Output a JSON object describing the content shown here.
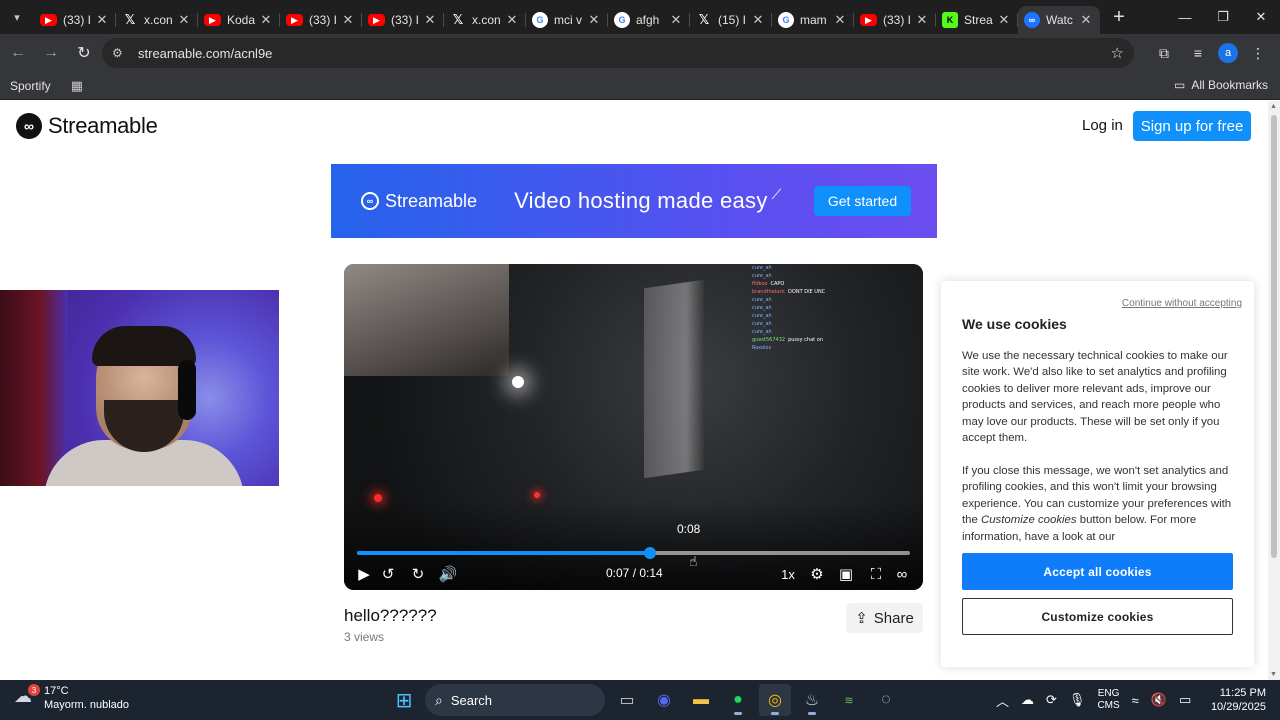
{
  "browser": {
    "tabs": [
      {
        "label": "(33) I",
        "icon": "youtube-icon",
        "active": false
      },
      {
        "label": "x.con",
        "icon": "x-icon",
        "active": false
      },
      {
        "label": "Koda",
        "icon": "youtube-icon",
        "active": false
      },
      {
        "label": "(33) I",
        "icon": "youtube-icon",
        "active": false
      },
      {
        "label": "(33) I",
        "icon": "youtube-icon",
        "active": false
      },
      {
        "label": "x.con",
        "icon": "x-icon",
        "active": false
      },
      {
        "label": "mci v",
        "icon": "google-icon",
        "active": false
      },
      {
        "label": "afgh",
        "icon": "google-icon",
        "active": false
      },
      {
        "label": "(15) I",
        "icon": "x-icon",
        "active": false
      },
      {
        "label": "mam",
        "icon": "google-icon",
        "active": false
      },
      {
        "label": "(33) I",
        "icon": "youtube-icon",
        "active": false
      },
      {
        "label": "Strea",
        "icon": "kick-icon",
        "active": false
      },
      {
        "label": "Watc",
        "icon": "streamable-icon",
        "active": true
      }
    ],
    "url": "streamable.com/acnl9e",
    "bookmarks": {
      "first": "Sportify",
      "all": "All Bookmarks"
    },
    "profile_initial": "a"
  },
  "site": {
    "brand": "Streamable",
    "login": "Log in",
    "signup": "Sign up for free",
    "banner": {
      "brand": "Streamable",
      "tagline": "Video hosting made easy",
      "cta": "Get started"
    }
  },
  "player": {
    "hover_time": "0:08",
    "time_display": "0:07 / 0:14",
    "speed": "1x",
    "progress": 0.53,
    "chat": [
      {
        "user": "cure_ah",
        "msg": "",
        "cls": "u"
      },
      {
        "user": "cure_ah",
        "msg": "",
        "cls": "u"
      },
      {
        "user": "ffdkoo",
        "msg": "CAPO",
        "cls": "u2"
      },
      {
        "user": "brandtheluck",
        "msg": "DONT DIE UNC",
        "cls": "u2"
      },
      {
        "user": "cure_ah",
        "msg": "",
        "cls": "u"
      },
      {
        "user": "cure_ah",
        "msg": "",
        "cls": "u"
      },
      {
        "user": "cure_ah",
        "msg": "",
        "cls": "u"
      },
      {
        "user": "cure_ah",
        "msg": "",
        "cls": "u"
      },
      {
        "user": "cure_ah",
        "msg": "",
        "cls": "u"
      },
      {
        "user": "guest567432",
        "msg": "pussy chat on",
        "cls": "u3"
      },
      {
        "user": "Roxolos",
        "msg": "",
        "cls": "u"
      }
    ]
  },
  "video": {
    "title": "hello??????",
    "views": "3 views",
    "share": "Share"
  },
  "cookies": {
    "continue": "Continue without accepting",
    "title": "We use cookies",
    "p1": "We use the necessary technical cookies to make our site work. We'd also like to set analytics and profiling cookies to deliver more relevant ads, improve our products and services, and reach more people who may love our products. These will be set only if you accept them.",
    "p2_a": "If you close this message, we won't set analytics and profiling cookies, and this won't limit your browsing experience. You can customize your preferences with the ",
    "p2_em": "Customize cookies",
    "p2_b": " button below. For more information, have a look at our",
    "accept": "Accept all cookies",
    "customize": "Customize cookies"
  },
  "taskbar": {
    "weather_badge": "3",
    "temp": "17°C",
    "condition": "Mayorm. nublado",
    "search": "Search",
    "lang1": "ENG",
    "lang2": "CMS",
    "time": "11:25 PM",
    "date": "10/29/2025"
  }
}
